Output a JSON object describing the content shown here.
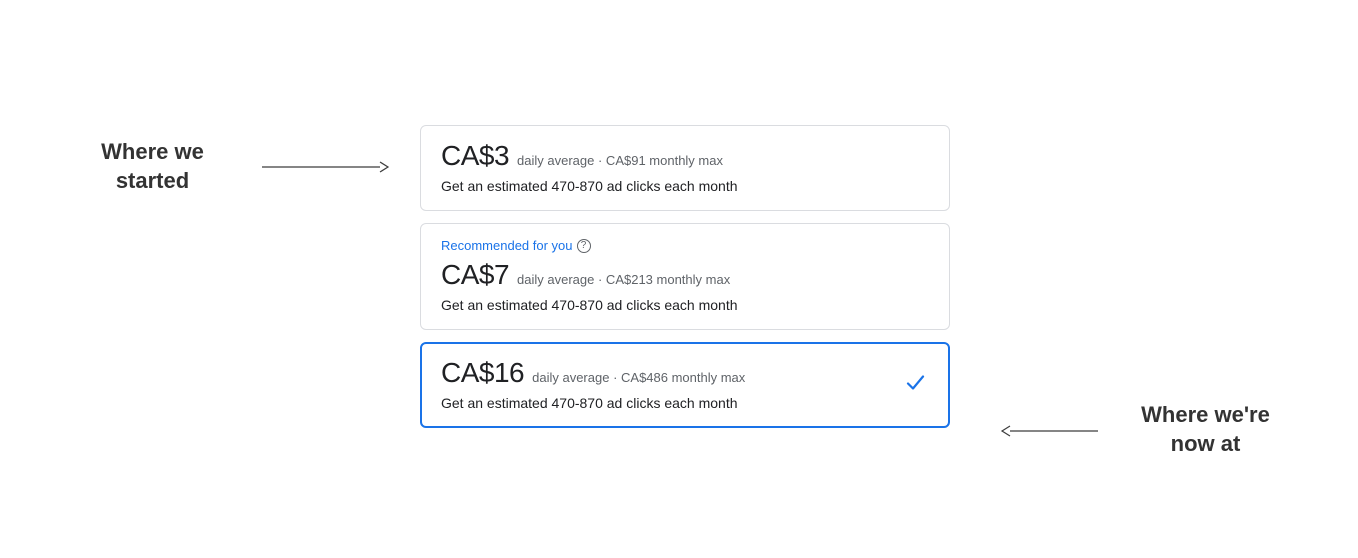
{
  "annotations": {
    "left": "Where we started",
    "right": "Where we're now at"
  },
  "budgets": [
    {
      "amount": "CA$3",
      "meta": "daily average · CA$91 monthly max",
      "estimate": "Get an estimated 470-870 ad clicks each month"
    },
    {
      "recommended": "Recommended for you",
      "amount": "CA$7",
      "meta": "daily average · CA$213 monthly max",
      "estimate": "Get an estimated 470-870 ad clicks each month"
    },
    {
      "amount": "CA$16",
      "meta": "daily average · CA$486 monthly max",
      "estimate": "Get an estimated 470-870 ad clicks each month"
    }
  ]
}
